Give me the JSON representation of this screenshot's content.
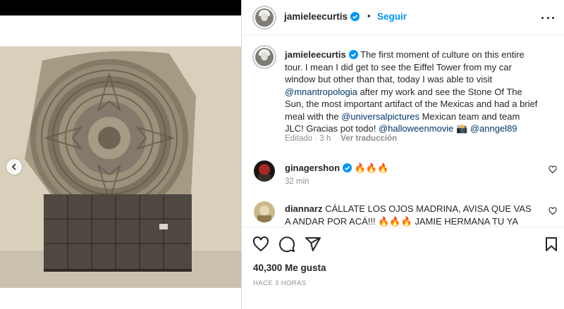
{
  "post": {
    "username": "jamieleecurtis",
    "follow_label": "Seguir",
    "dot": "•",
    "caption": {
      "username": "jamieleecurtis",
      "text_1": "The first moment of culture on this entire tour. I mean I did get to see the Eiffel Tower from my car window but other than that, today I was able to visit",
      "mention_1": "@mnantropologia",
      "text_2": "after my work and see the Stone Of The Sun, the most important artifact of the Mexicas and had a brief meal with the",
      "mention_2": "@universalpictures",
      "text_3": "Mexican team and team JLC! Gracias pot todo!",
      "mention_3": "@halloweenmovie",
      "emoji": "📸",
      "mention_4": "@anngel89",
      "edited": "Editado · 3 h",
      "translate": "Ver traducción"
    },
    "comments": [
      {
        "username": "ginagershon",
        "text": "🔥🔥🔥",
        "time": "32 min"
      },
      {
        "username": "diannarz",
        "text": "CÁLLATE LOS OJOS MADRINA, AVISA QUE VAS A ANDAR POR ACÁ!!! 🔥🔥🔥 JAMIE HERMANA TU YA ERES"
      }
    ],
    "likes": "40,300 Me gusta",
    "timestamp": "HACE 3 HORAS",
    "colors": {
      "accent": "#0095f6",
      "link": "#00376b",
      "muted": "#8e8e8e"
    }
  },
  "icons": {
    "verified": "verified-badge-icon",
    "more": "more-options-icon",
    "like": "heart-icon",
    "comment": "comment-icon",
    "share": "share-icon",
    "save": "bookmark-icon",
    "prev": "chevron-left-icon"
  }
}
